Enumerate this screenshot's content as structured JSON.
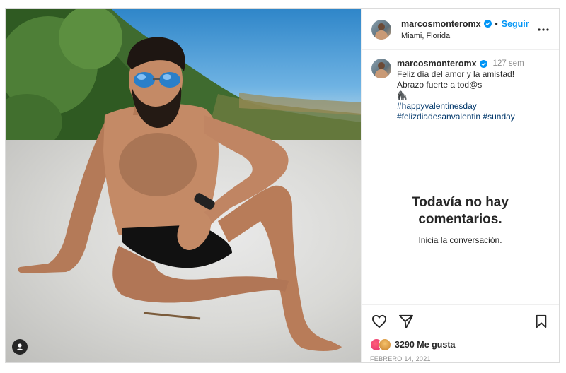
{
  "post": {
    "username": "marcosmonteromx",
    "verified": true,
    "follow_label": "Seguir",
    "separator": "•",
    "location": "Miami, Florida",
    "avatar_icon": "user-avatar",
    "more_icon": "more-options-icon"
  },
  "caption": {
    "username": "marcosmonteromx",
    "time_ago": "127 sem",
    "lines": [
      "Feliz día del amor y la amistad!",
      "Abrazo fuerte a tod@s"
    ],
    "emoji": "🦍",
    "hashtags": [
      "#happyvalentinesday",
      "#felizdiadesanvalentin #sunday"
    ]
  },
  "comments": {
    "empty_title_line1": "Todavía no hay",
    "empty_title_line2": "comentarios.",
    "empty_subtitle": "Inicia la conversación."
  },
  "engagement": {
    "likes_count_label": "3290 Me gusta",
    "date": "FEBRERO 14, 2021",
    "icons": [
      "heart-icon",
      "share-icon",
      "bookmark-icon"
    ]
  },
  "colors": {
    "link_blue": "#0095f6",
    "hashtag": "#00376b",
    "muted": "#8e8e8e",
    "border": "#dbdbdb"
  }
}
